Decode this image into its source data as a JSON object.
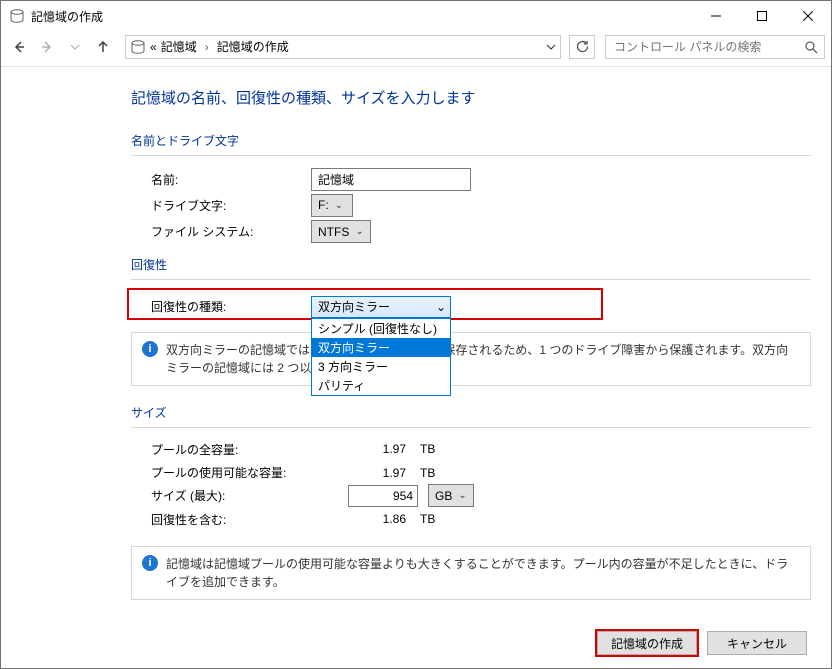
{
  "window": {
    "title": "記憶域の作成"
  },
  "nav": {
    "breadcrumb_prefix": "«",
    "crumb1": "記憶域",
    "crumb2": "記憶域の作成",
    "search_placeholder": "コントロール パネルの検索"
  },
  "page": {
    "heading": "記憶域の名前、回復性の種類、サイズを入力します",
    "grp_name": "名前とドライブ文字",
    "name_label": "名前:",
    "name_value": "記憶域",
    "drive_label": "ドライブ文字:",
    "drive_value": "F:",
    "fs_label": "ファイル システム:",
    "fs_value": "NTFS",
    "grp_resi": "回復性",
    "resi_type_label": "回復性の種類:",
    "resi_type_value": "双方向ミラー",
    "resi_options": {
      "o0": "シンプル (回復性なし)",
      "o1": "双方向ミラー",
      "o2": "3 方向ミラー",
      "o3": "パリティ"
    },
    "resi_info": "双方向ミラーの記憶域では、データのコピーが 2 つ保存されるため、1 つのドライブ障害から保護されます。双方向ミラーの記憶域には 2 つ以上のドライブが必要です。",
    "grp_size": "サイズ",
    "size_total_label": "プールの全容量:",
    "size_total_value": "1.97",
    "size_total_unit": "TB",
    "size_avail_label": "プールの使用可能な容量:",
    "size_avail_value": "1.97",
    "size_avail_unit": "TB",
    "size_max_label": "サイズ (最大):",
    "size_max_value": "954",
    "size_max_unit": "GB",
    "size_resi_label": "回復性を含む:",
    "size_resi_value": "1.86",
    "size_resi_unit": "TB",
    "size_info": "記憶域は記憶域プールの使用可能な容量よりも大きくすることができます。プール内の容量が不足したときに、ドライブを追加できます。"
  },
  "footer": {
    "create": "記憶域の作成",
    "cancel": "キャンセル"
  }
}
